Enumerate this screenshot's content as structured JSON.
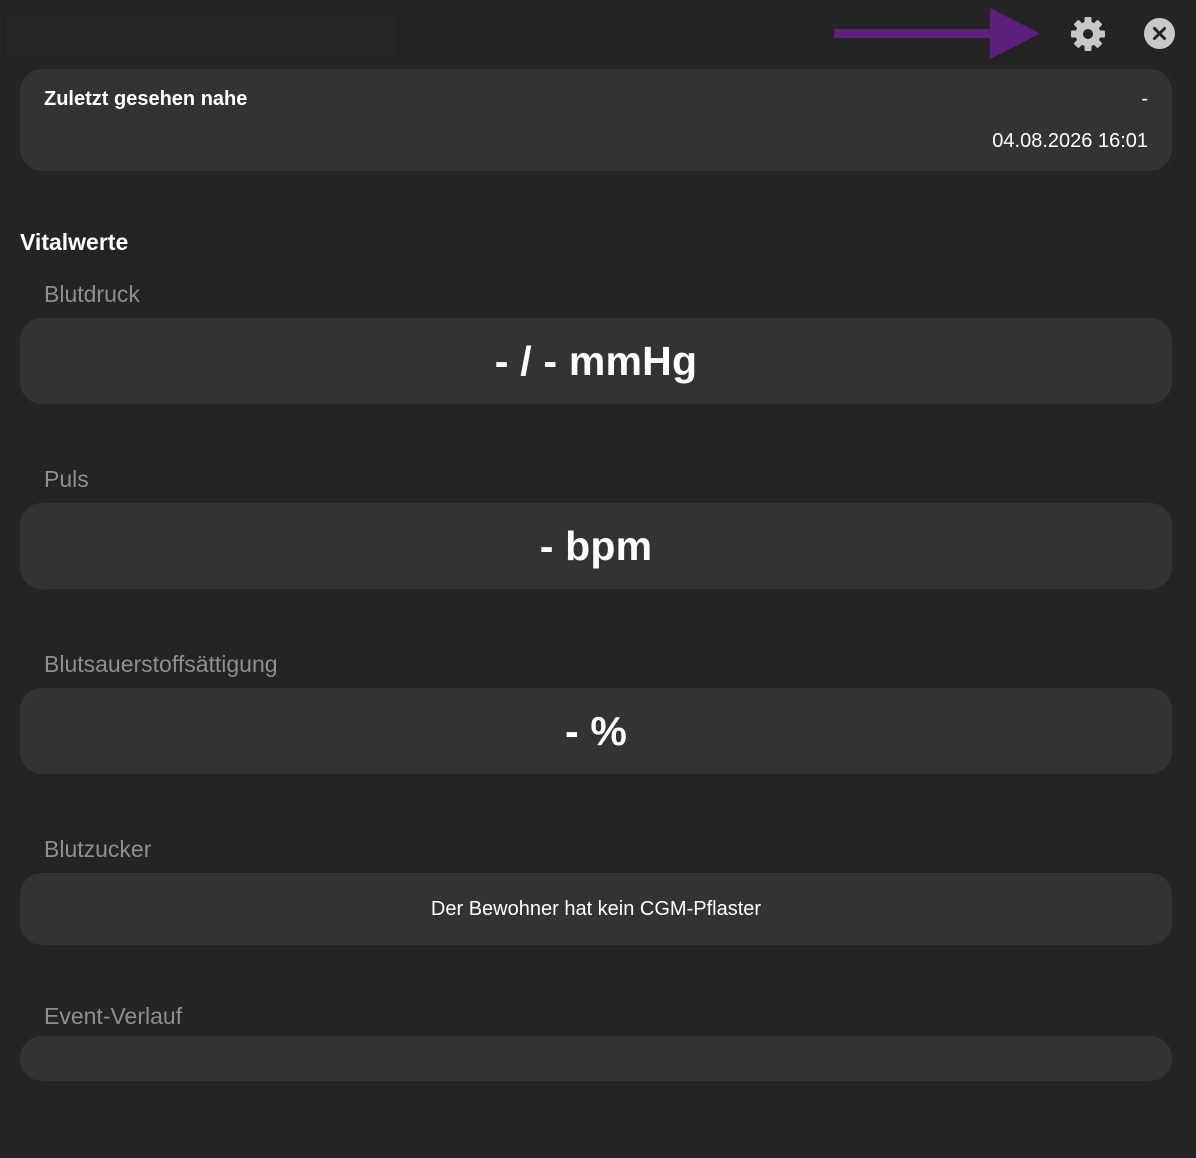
{
  "header": {
    "settings_icon": "gear-icon",
    "close_icon": "close-icon",
    "annotation_arrow_color": "#5e1f7d"
  },
  "last_seen": {
    "label": "Zuletzt gesehen nahe",
    "location": "-",
    "timestamp": "04.08.2026 16:01"
  },
  "vitals": {
    "heading": "Vitalwerte",
    "blood_pressure": {
      "label": "Blutdruck",
      "value": "- / - mmHg"
    },
    "pulse": {
      "label": "Puls",
      "value": "- bpm"
    },
    "oxygen_saturation": {
      "label": "Blutsauerstoffsättigung",
      "value": "- %"
    },
    "blood_sugar": {
      "label": "Blutzucker",
      "value": "Der Bewohner hat kein CGM-Pflaster"
    }
  },
  "event_history": {
    "label": "Event-Verlauf"
  },
  "colors": {
    "background": "#242424",
    "card": "#333333",
    "muted_label": "#8f8f8f",
    "text": "#ffffff"
  }
}
